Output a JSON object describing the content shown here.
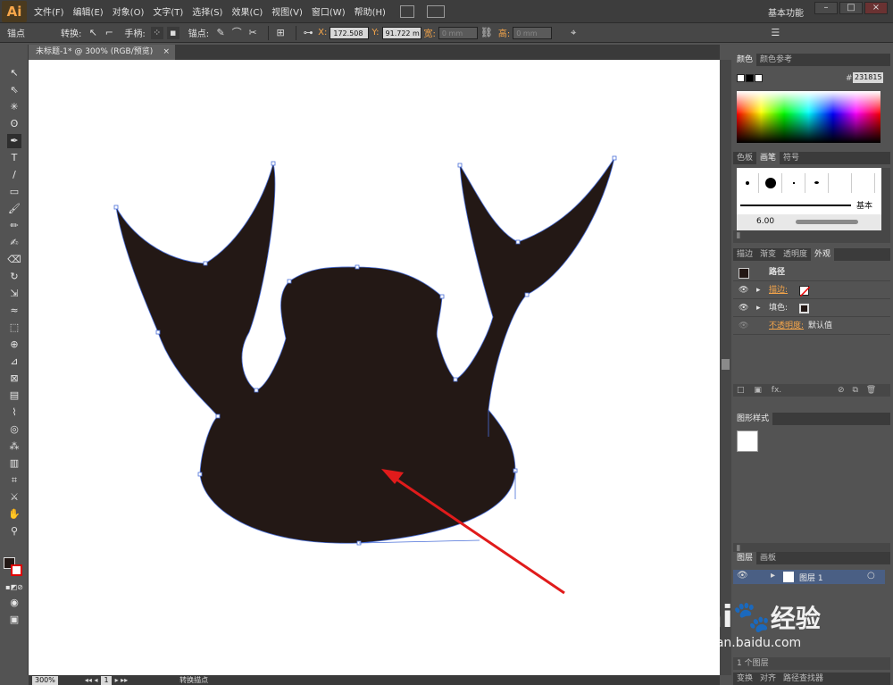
{
  "menubar": {
    "logo": "Ai",
    "items": [
      "文件(F)",
      "编辑(E)",
      "对象(O)",
      "文字(T)",
      "选择(S)",
      "效果(C)",
      "视图(V)",
      "窗口(W)",
      "帮助(H)"
    ],
    "workspace": "基本功能",
    "window_controls": [
      "–",
      "□",
      "×"
    ]
  },
  "controlbar": {
    "anchor_label": "锚点",
    "convert_label": "转换:",
    "handles_label": "手柄:",
    "anchors_label": "锚点:",
    "x_label": "X:",
    "x_value": "172.508",
    "y_label": "Y:",
    "y_value": "91.722 m",
    "w_label": "宽:",
    "w_value": "0 mm",
    "h_label": "高:",
    "h_value": "0 mm"
  },
  "document": {
    "tab_title": "未标题-1* @ 300% (RGB/预览)",
    "tab_close": "×"
  },
  "statusbar": {
    "zoom": "300%",
    "page": "1",
    "tool_status": "转换描点"
  },
  "panels": {
    "color": {
      "tabs": [
        "颜色",
        "颜色参考"
      ],
      "hex_label": "#",
      "hex_value": "231815"
    },
    "brushes": {
      "tabs": [
        "色板",
        "画笔",
        "符号"
      ],
      "basic_label": "基本",
      "size_value": "6.00"
    },
    "appearance": {
      "tabs": [
        "描边",
        "渐变",
        "透明度",
        "外观"
      ],
      "object_label": "路径",
      "stroke_label": "描边:",
      "fill_label": "填色:",
      "opacity_label": "不透明度:",
      "opacity_value": "默认值",
      "footer_fx": "fx."
    },
    "graphic_styles": {
      "tabs": [
        "图形样式"
      ]
    },
    "layers": {
      "tabs": [
        "图层",
        "画板"
      ],
      "layer_name": "图层 1",
      "footer_count": "1 个图层"
    },
    "bottom": {
      "tabs": [
        "变换",
        "对齐",
        "路径查找器"
      ]
    }
  },
  "watermark": {
    "brand": "Bai",
    "brand2": "经验",
    "url": "jingyan.baidu.com"
  },
  "colors": {
    "shape_fill": "#231815",
    "path_outline": "#4a6fd8",
    "arrow": "#e01b1b",
    "accent": "#f7a64a"
  }
}
